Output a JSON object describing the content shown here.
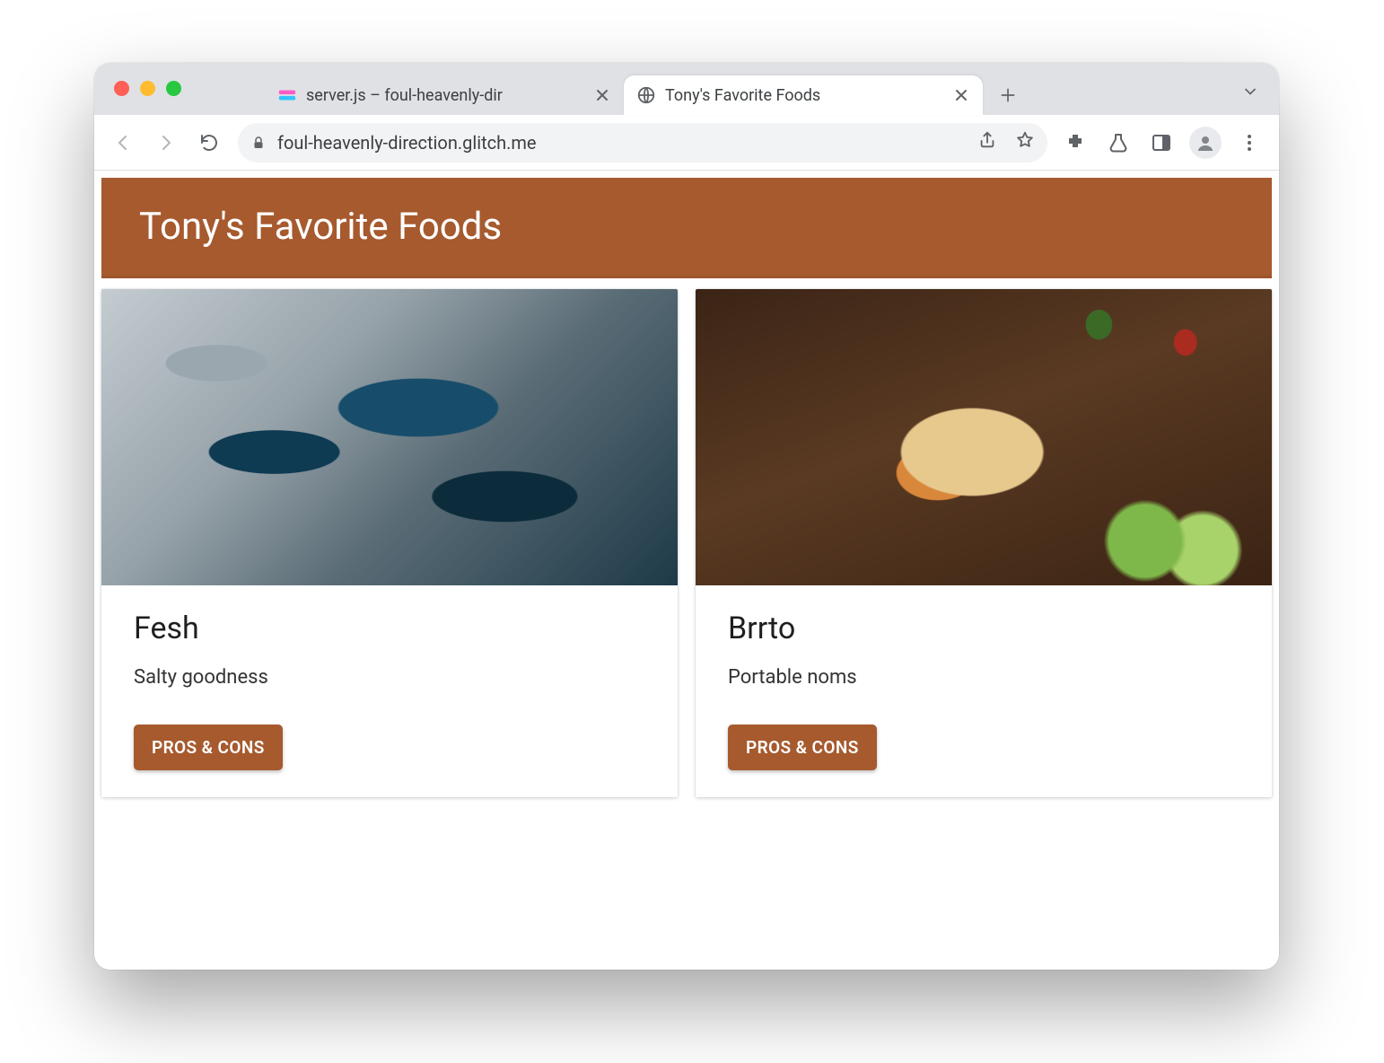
{
  "browser": {
    "tabs": [
      {
        "title": "server.js – foul-heavenly-dir",
        "active": false,
        "favicon": "glitch-icon"
      },
      {
        "title": "Tony's Favorite Foods",
        "active": true,
        "favicon": "globe-icon"
      }
    ],
    "url": "foul-heavenly-direction.glitch.me"
  },
  "page": {
    "header_title": "Tony's Favorite Foods",
    "cards": [
      {
        "image": "fish",
        "title": "Fesh",
        "description": "Salty goodness",
        "button_label": "PROS & CONS"
      },
      {
        "image": "burrito",
        "title": "Brrto",
        "description": "Portable noms",
        "button_label": "PROS & CONS"
      }
    ]
  },
  "colors": {
    "accent": "#a65a2e"
  }
}
